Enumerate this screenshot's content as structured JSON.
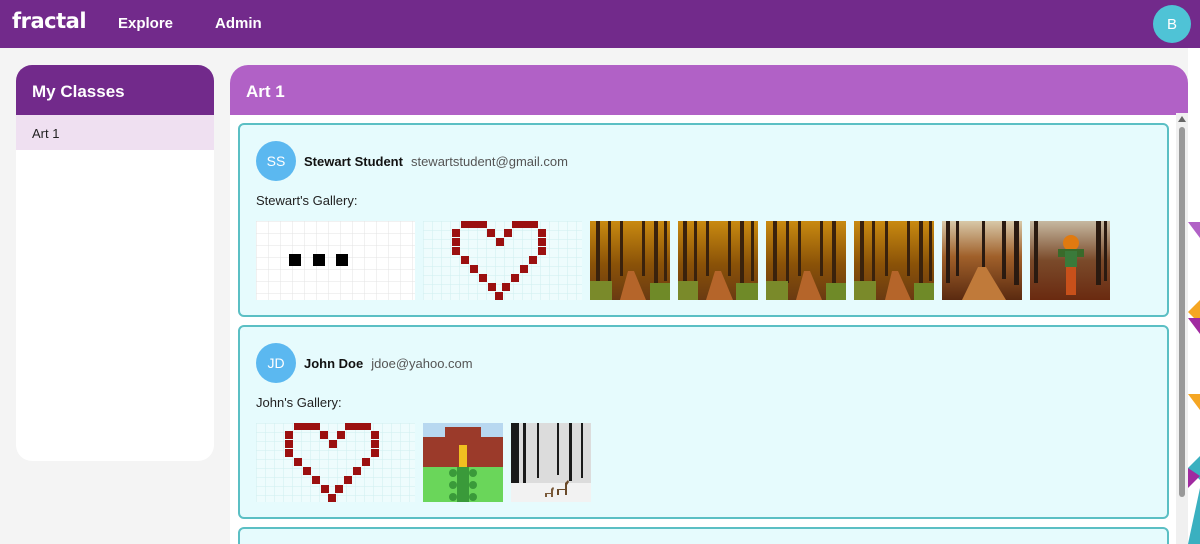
{
  "nav": {
    "logo": "fractal",
    "explore_label": "Explore",
    "admin_label": "Admin",
    "user_initial": "B"
  },
  "sidebar": {
    "title": "My Classes",
    "items": [
      {
        "label": "Art 1"
      }
    ]
  },
  "main": {
    "title": "Art 1",
    "students": [
      {
        "initials": "SS",
        "name": "Stewart Student",
        "email": "stewartstudent@gmail.com",
        "gallery_label": "Stewart's Gallery:",
        "gallery": [
          "pixel-dots",
          "pixel-heart",
          "autumn-forest",
          "autumn-forest",
          "autumn-forest",
          "autumn-forest",
          "autumn-path",
          "autumn-scarecrow"
        ]
      },
      {
        "initials": "JD",
        "name": "John Doe",
        "email": "jdoe@yahoo.com",
        "gallery_label": "John's Gallery:",
        "gallery": [
          "pixel-heart",
          "pixel-house",
          "snowy-forest-deer"
        ]
      }
    ]
  },
  "colors": {
    "nav_bg": "#722a8b",
    "header_bg": "#b161c6",
    "card_bg": "#e6fbfd",
    "card_border": "#5bbfc4",
    "avatar": "#5bb8f0"
  }
}
